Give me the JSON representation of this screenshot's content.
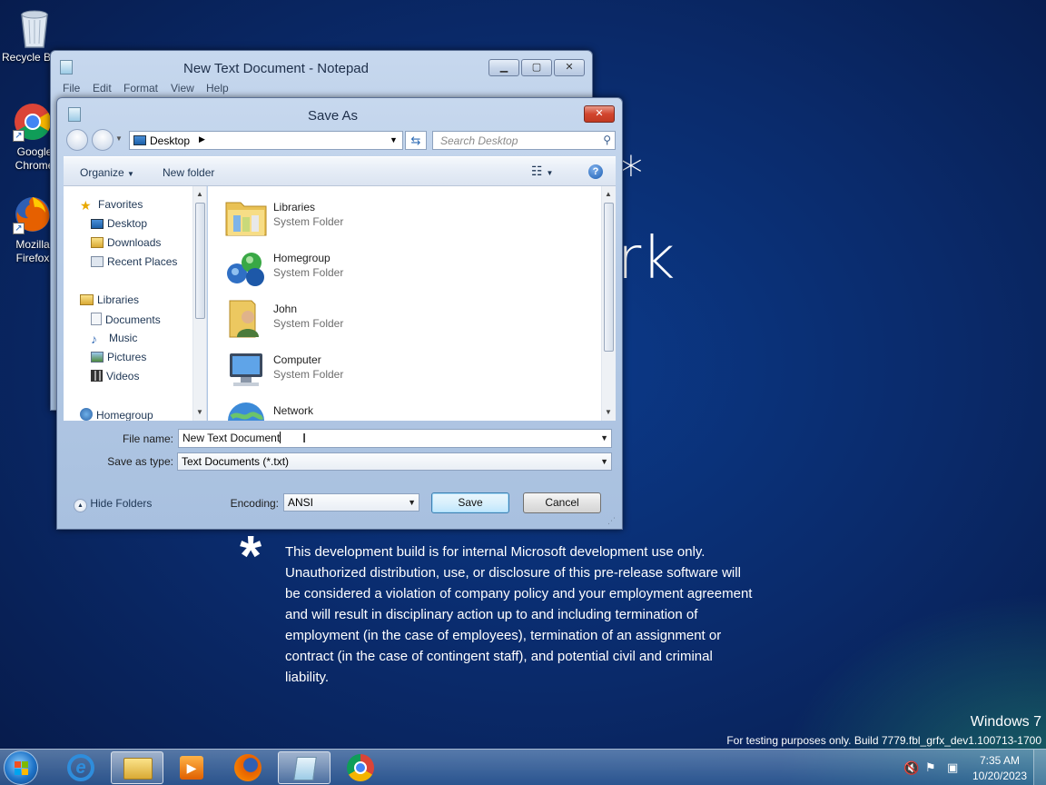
{
  "desktop": {
    "icons": [
      {
        "label": "Recycle Bin",
        "name": "recycle-bin"
      },
      {
        "label": "Google Chrome",
        "name": "chrome"
      },
      {
        "label": "Mozilla Firefox",
        "name": "firefox"
      }
    ],
    "watermark_partial_1": "*",
    "watermark_partial_2": "rk",
    "dev_notice": "This development build is for internal Microsoft development use only. Unauthorized distribution, use, or disclosure of this pre-release software will be considered a violation of company policy and your employment agreement and will result in disciplinary action up to and including termination of employment (in the case of employees), termination of an assignment or contract (in the case of contingent staff), and potential civil and criminal liability.",
    "asterisk": "*",
    "brand": "Windows 7",
    "build": "For testing purposes only. Build 7779.fbl_grfx_dev1.100713-1700"
  },
  "notepad": {
    "title": "New Text Document - Notepad",
    "menu": [
      "File",
      "Edit",
      "Format",
      "View",
      "Help"
    ]
  },
  "dialog": {
    "title": "Save As",
    "address": "Desktop",
    "search_placeholder": "Search Desktop",
    "toolbar": {
      "organize": "Organize",
      "new_folder": "New folder"
    },
    "nav": {
      "favorites": "Favorites",
      "favorites_items": [
        "Desktop",
        "Downloads",
        "Recent Places"
      ],
      "libraries": "Libraries",
      "libraries_items": [
        "Documents",
        "Music",
        "Pictures",
        "Videos"
      ],
      "homegroup": "Homegroup"
    },
    "files": [
      {
        "name": "Libraries",
        "type": "System Folder"
      },
      {
        "name": "Homegroup",
        "type": "System Folder"
      },
      {
        "name": "John",
        "type": "System Folder"
      },
      {
        "name": "Computer",
        "type": "System Folder"
      },
      {
        "name": "Network",
        "type": ""
      }
    ],
    "file_name_label": "File name:",
    "file_name_value": "New Text Document",
    "save_type_label": "Save as type:",
    "save_type_value": "Text Documents (*.txt)",
    "hide_folders": "Hide Folders",
    "encoding_label": "Encoding:",
    "encoding_value": "ANSI",
    "save": "Save",
    "cancel": "Cancel"
  },
  "taskbar": {
    "time": "7:35 AM",
    "date": "10/20/2023"
  },
  "colors": {
    "title_text": "#1e2f4a",
    "close_red": "#c23a22",
    "link_blue": "#1e3654"
  }
}
